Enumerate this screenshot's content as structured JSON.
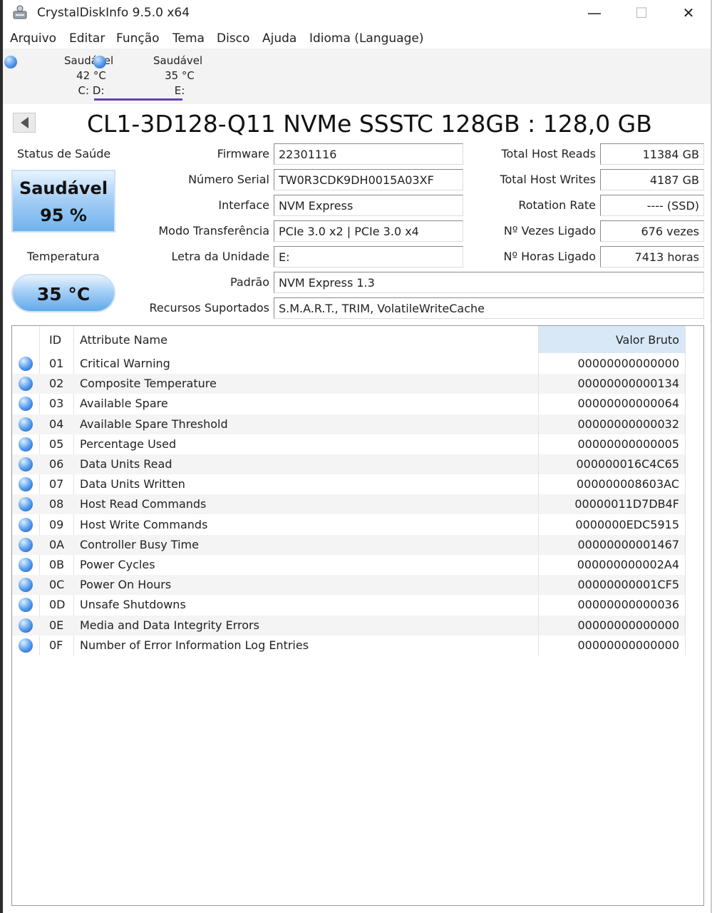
{
  "window": {
    "title": "CrystalDiskInfo 9.5.0 x64",
    "minimize_glyph": "—",
    "maximize_glyph": "☐",
    "close_glyph": "✕"
  },
  "menu": [
    "Arquivo",
    "Editar",
    "Função",
    "Tema",
    "Disco",
    "Ajuda",
    "Idioma (Language)"
  ],
  "drives": [
    {
      "status": "Saudável",
      "temp": "42 °C",
      "letter": "C: D:"
    },
    {
      "status": "Saudável",
      "temp": "35 °C",
      "letter": "E:"
    }
  ],
  "model": {
    "title": "CL1-3D128-Q11 NVMe SSSTC 128GB : 128,0 GB"
  },
  "health": {
    "status_label": "Status de Saúde",
    "status": "Saudável",
    "percent": "95 %",
    "temp_label": "Temperatura",
    "temp": "35 °C"
  },
  "info_left": [
    {
      "label": "Firmware",
      "value": "22301116"
    },
    {
      "label": "Número Serial",
      "value": "TW0R3CDK9DH0015A03XF"
    },
    {
      "label": "Interface",
      "value": "NVM Express"
    },
    {
      "label": "Modo Transferência",
      "value": "PCIe 3.0 x2 | PCIe 3.0 x4"
    },
    {
      "label": "Letra da Unidade",
      "value": "E:"
    }
  ],
  "info_right": [
    {
      "label": "Total Host Reads",
      "value": "11384 GB"
    },
    {
      "label": "Total Host Writes",
      "value": "4187 GB"
    },
    {
      "label": "Rotation Rate",
      "value": "---- (SSD)"
    },
    {
      "label": "Nº Vezes Ligado",
      "value": "676 vezes"
    },
    {
      "label": "Nº Horas Ligado",
      "value": "7413 horas"
    }
  ],
  "info_wide": [
    {
      "label": "Padrão",
      "value": "NVM Express 1.3"
    },
    {
      "label": "Recursos Suportados",
      "value": "S.M.A.R.T., TRIM, VolatileWriteCache"
    }
  ],
  "attributes": {
    "headers": {
      "id": "ID",
      "name": "Attribute Name",
      "raw": "Valor Bruto"
    },
    "rows": [
      {
        "id": "01",
        "name": "Critical Warning",
        "raw": "00000000000000"
      },
      {
        "id": "02",
        "name": "Composite Temperature",
        "raw": "00000000000134"
      },
      {
        "id": "03",
        "name": "Available Spare",
        "raw": "00000000000064"
      },
      {
        "id": "04",
        "name": "Available Spare Threshold",
        "raw": "00000000000032"
      },
      {
        "id": "05",
        "name": "Percentage Used",
        "raw": "00000000000005"
      },
      {
        "id": "06",
        "name": "Data Units Read",
        "raw": "000000016C4C65"
      },
      {
        "id": "07",
        "name": "Data Units Written",
        "raw": "000000008603AC"
      },
      {
        "id": "08",
        "name": "Host Read Commands",
        "raw": "00000011D7DB4F"
      },
      {
        "id": "09",
        "name": "Host Write Commands",
        "raw": "0000000EDC5915"
      },
      {
        "id": "0A",
        "name": "Controller Busy Time",
        "raw": "00000000001467"
      },
      {
        "id": "0B",
        "name": "Power Cycles",
        "raw": "000000000002A4"
      },
      {
        "id": "0C",
        "name": "Power On Hours",
        "raw": "00000000001CF5"
      },
      {
        "id": "0D",
        "name": "Unsafe Shutdowns",
        "raw": "00000000000036"
      },
      {
        "id": "0E",
        "name": "Media and Data Integrity Errors",
        "raw": "00000000000000"
      },
      {
        "id": "0F",
        "name": "Number of Error Information Log Entries",
        "raw": "00000000000000"
      }
    ]
  }
}
